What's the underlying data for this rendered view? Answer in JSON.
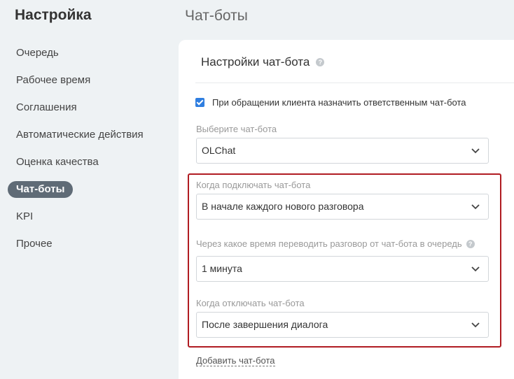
{
  "sidebar": {
    "title": "Настройка",
    "items": [
      {
        "label": "Очередь"
      },
      {
        "label": "Рабочее время"
      },
      {
        "label": "Соглашения"
      },
      {
        "label": "Автоматические действия"
      },
      {
        "label": "Оценка качества"
      },
      {
        "label": "Чат-боты"
      },
      {
        "label": "KPI"
      },
      {
        "label": "Прочее"
      }
    ],
    "active_index": 5
  },
  "page": {
    "title": "Чат-боты"
  },
  "panel": {
    "title": "Настройки чат-бота",
    "assign_checkbox": {
      "label": "При обращении клиента назначить ответственным чат-бота",
      "checked": true
    },
    "fields": {
      "bot": {
        "label": "Выберите чат-бота",
        "value": "OLChat"
      },
      "connect_when": {
        "label": "Когда подключать чат-бота",
        "value": "В начале каждого нового разговора"
      },
      "transfer_after": {
        "label": "Через какое время переводить разговор от чат-бота в очередь",
        "value": "1 минута"
      },
      "disconnect_when": {
        "label": "Когда отключать чат-бота",
        "value": "После завершения диалога"
      }
    },
    "add_bot_link": "Добавить чат-бота"
  },
  "colors": {
    "accent": "#2f7ee0",
    "active_nav": "#5f6b76",
    "highlight": "#b01c22"
  },
  "icons": {
    "help": "question-circle-icon",
    "dropdown": "chevron-down-icon",
    "checkbox": "checkmark-icon"
  }
}
